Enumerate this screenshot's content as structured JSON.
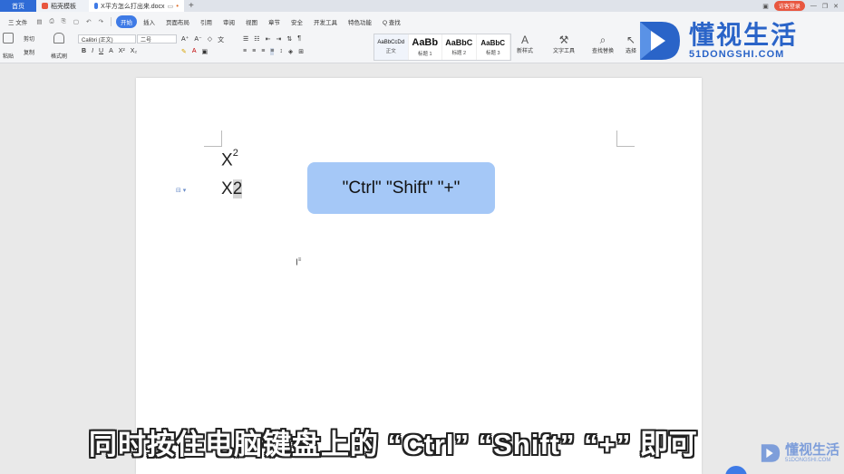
{
  "tabs": [
    {
      "label": "首页"
    },
    {
      "label": "稻壳模板"
    },
    {
      "label": "X平方怎么打出来.docx"
    }
  ],
  "tabbar_right": {
    "login": "访客登录"
  },
  "menu": {
    "file": "三 文件",
    "items": [
      "开始",
      "插入",
      "页面布局",
      "引用",
      "审阅",
      "视图",
      "章节",
      "安全",
      "开发工具",
      "特色功能"
    ],
    "search": "Q 查找",
    "right": [
      "未同步",
      "分享",
      "批注"
    ]
  },
  "ribbon": {
    "paste": "粘贴",
    "cut": "剪切",
    "copy": "复制",
    "format_painter": "格式刷",
    "font_name": "Calibri (正文)",
    "font_size": "二号",
    "format_buttons": [
      "B",
      "I",
      "U",
      "A",
      "X²",
      "X₂"
    ],
    "styles": [
      {
        "sample": "AaBbCcDd",
        "name": "正文"
      },
      {
        "sample": "AaBb",
        "name": "标题 1"
      },
      {
        "sample": "AaBbC",
        "name": "标题 2"
      },
      {
        "sample": "AaBbC",
        "name": "标题 3"
      }
    ],
    "new_style": "新样式",
    "text_tools": "文字工具",
    "find_replace": "查找替换",
    "select": "选择"
  },
  "watermark": {
    "cn": "懂视生活",
    "en": "51DONGSHI.COM"
  },
  "document": {
    "line1_base": "X",
    "line1_sup": "2",
    "line2_x": "X",
    "line2_sel": "2"
  },
  "callout": "\"Ctrl\" \"Shift\" \"+\"",
  "subtitle": "同时按住电脑键盘上的 “Ctrl” “Shift” “+” 即可",
  "watermark_small": {
    "cn": "懂视生活",
    "en": "51DONGSHI.COM"
  },
  "colors": {
    "accent": "#3f7be6",
    "callout_bg": "#a5c8f7",
    "watermark": "#2a64c8"
  }
}
